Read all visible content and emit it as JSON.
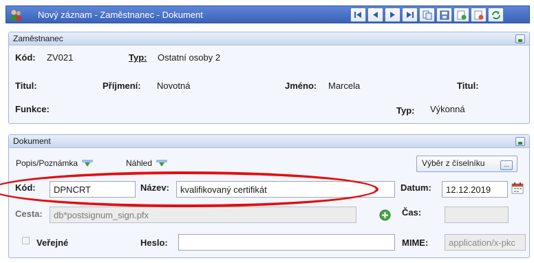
{
  "window": {
    "title": "Nový záznam - Zaměstnanec - Dokument"
  },
  "employee_panel": {
    "header": "Zaměstnanec",
    "kod_label": "Kód:",
    "kod_value": "ZV021",
    "typ_label": "Typ:",
    "typ_value": "Ostatní osoby 2",
    "titul_label": "Titul:",
    "prijmeni_label": "Příjmení:",
    "prijmeni_value": "Novotná",
    "jmeno_label": "Jméno:",
    "jmeno_value": "Marcela",
    "titul2_label": "Titul:",
    "funkce_label": "Funkce:",
    "typ2_label": "Typ:",
    "typ2_value": "Výkonná"
  },
  "document_panel": {
    "header": "Dokument",
    "tab_popis": "Popis/Poznámka",
    "tab_nahled": "Náhled",
    "catalog_button": "Výběr z číselníku",
    "catalog_button_dots": "...",
    "kod_label": "Kód:",
    "kod_value": "DPNCRT",
    "nazev_label": "Název:",
    "nazev_value": "kvalifikovaný certifikát",
    "datum_label": "Datum:",
    "datum_value": "12.12.2019",
    "cesta_label": "Cesta:",
    "cesta_value": "db*postsignum_sign.pfx",
    "cas_label": "Čas:",
    "cas_value": "",
    "verejne_label": "Veřejné",
    "heslo_label": "Heslo:",
    "heslo_value": "",
    "mime_label": "MIME:",
    "mime_value": "application/x-pkc"
  },
  "colors": {
    "titlebar": "#3a62b8",
    "panel_border": "#9db3dd",
    "annotation": "#e20f0f"
  },
  "icons": [
    "user-group-icon",
    "first-record-icon",
    "prev-record-icon",
    "next-record-icon",
    "last-record-icon",
    "copy-icon",
    "save-icon",
    "save-new-icon",
    "delete-icon",
    "refresh-icon",
    "calendar-icon",
    "add-icon"
  ]
}
